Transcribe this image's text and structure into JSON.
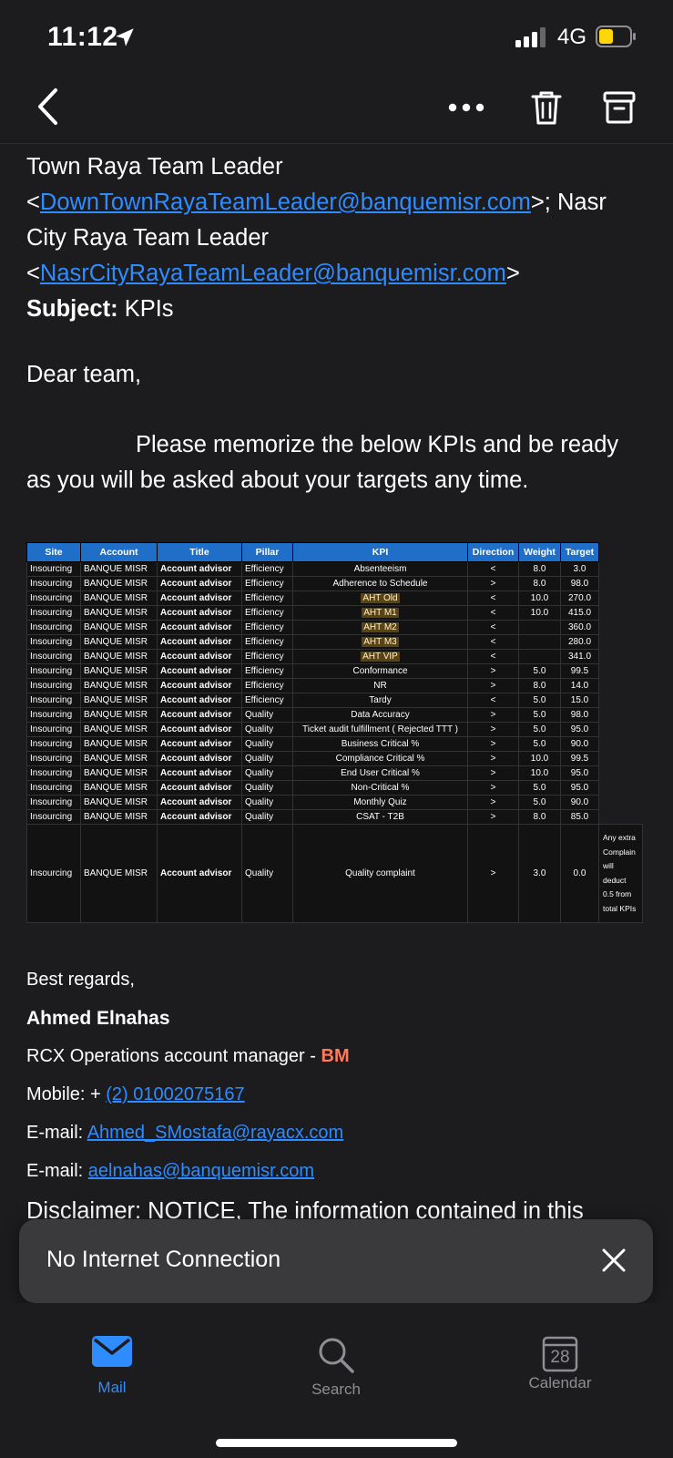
{
  "status": {
    "time": "11:12",
    "network": "4G"
  },
  "email": {
    "to_line1": "Town Raya Team Leader",
    "to_lt1": "<",
    "to_email1": "DownTownRayaTeamLeader@banquemisr.com",
    "to_after1": ">; Nasr",
    "to_line3": "City Raya Team Leader",
    "to_lt2": "<",
    "to_email2": "NasrCityRayaTeamLeader@banquemisr.com",
    "to_gt2": ">",
    "subject_label": "Subject:",
    "subject_value": "KPIs",
    "greeting": "Dear team,",
    "body_line1": "Please memorize the below KPIs and be ready",
    "body_line2": "as you will be asked about your targets any time."
  },
  "kpi_table": {
    "headers": [
      "Site",
      "Account",
      "Title",
      "Pillar",
      "KPI",
      "Direction",
      "Weight",
      "Target"
    ],
    "rows": [
      [
        "Insourcing",
        "BANQUE MISR",
        "Account advisor",
        "Efficiency",
        "Absenteeism",
        "<",
        "8.0",
        "3.0"
      ],
      [
        "Insourcing",
        "BANQUE MISR",
        "Account advisor",
        "Efficiency",
        "Adherence to Schedule",
        ">",
        "8.0",
        "98.0"
      ],
      [
        "Insourcing",
        "BANQUE MISR",
        "Account advisor",
        "Efficiency",
        "AHT Old",
        "<",
        "10.0",
        "270.0"
      ],
      [
        "Insourcing",
        "BANQUE MISR",
        "Account advisor",
        "Efficiency",
        "AHT M1",
        "<",
        "10.0",
        "415.0"
      ],
      [
        "Insourcing",
        "BANQUE MISR",
        "Account advisor",
        "Efficiency",
        "AHT M2",
        "<",
        "",
        "360.0"
      ],
      [
        "Insourcing",
        "BANQUE MISR",
        "Account advisor",
        "Efficiency",
        "AHT M3",
        "<",
        "",
        "280.0"
      ],
      [
        "Insourcing",
        "BANQUE MISR",
        "Account advisor",
        "Efficiency",
        "AHT VIP",
        "<",
        "",
        "341.0"
      ],
      [
        "Insourcing",
        "BANQUE MISR",
        "Account advisor",
        "Efficiency",
        "Conformance",
        ">",
        "5.0",
        "99.5"
      ],
      [
        "Insourcing",
        "BANQUE MISR",
        "Account advisor",
        "Efficiency",
        "NR",
        ">",
        "8.0",
        "14.0"
      ],
      [
        "Insourcing",
        "BANQUE MISR",
        "Account advisor",
        "Efficiency",
        "Tardy",
        "<",
        "5.0",
        "15.0"
      ],
      [
        "Insourcing",
        "BANQUE MISR",
        "Account advisor",
        "Quality",
        "Data Accuracy",
        ">",
        "5.0",
        "98.0"
      ],
      [
        "Insourcing",
        "BANQUE MISR",
        "Account advisor",
        "Quality",
        "Ticket audit fulfillment ( Rejected TTT )",
        ">",
        "5.0",
        "95.0"
      ],
      [
        "Insourcing",
        "BANQUE MISR",
        "Account advisor",
        "Quality",
        "Business Critical %",
        ">",
        "5.0",
        "90.0"
      ],
      [
        "Insourcing",
        "BANQUE MISR",
        "Account advisor",
        "Quality",
        "Compliance Critical %",
        ">",
        "10.0",
        "99.5"
      ],
      [
        "Insourcing",
        "BANQUE MISR",
        "Account advisor",
        "Quality",
        "End User Critical %",
        ">",
        "10.0",
        "95.0"
      ],
      [
        "Insourcing",
        "BANQUE MISR",
        "Account advisor",
        "Quality",
        "Non-Critical %",
        ">",
        "5.0",
        "95.0"
      ],
      [
        "Insourcing",
        "BANQUE MISR",
        "Account advisor",
        "Quality",
        "Monthly Quiz",
        ">",
        "5.0",
        "90.0"
      ],
      [
        "Insourcing",
        "BANQUE MISR",
        "Account advisor",
        "Quality",
        "CSAT - T2B",
        ">",
        "8.0",
        "85.0"
      ]
    ],
    "highlighted_kpis": [
      "AHT Old",
      "AHT M1",
      "AHT M2",
      "AHT M3",
      "AHT VIP"
    ],
    "last_row": [
      "Insourcing",
      "BANQUE MISR",
      "Account advisor",
      "Quality",
      "Quality complaint",
      ">",
      "3.0",
      "0.0"
    ],
    "last_row_note": "Any extra Complain will deduct 0.5 from total KPIs"
  },
  "signature": {
    "closing": "Best regards,",
    "name": "Ahmed Elnahas",
    "role_text": "RCX Operations account manager - ",
    "role_accent": "BM",
    "mobile_label": "Mobile: + ",
    "mobile_value": "(2) 01002075167",
    "email1_label": "E-mail: ",
    "email1_value": "Ahmed_SMostafa@rayacx.com",
    "email2_label": "E-mail: ",
    "email2_value": "aelnahas@banquemisr.com",
    "disclaimer": "Disclaimer: NOTICE, The information contained in this"
  },
  "toast": {
    "message": "No Internet Connection"
  },
  "tabs": [
    {
      "label": "Mail",
      "icon": "mail-icon",
      "active": true
    },
    {
      "label": "Search",
      "icon": "search-icon",
      "active": false
    },
    {
      "label": "Calendar",
      "icon": "calendar-icon",
      "active": false,
      "badge": "28"
    }
  ],
  "colors": {
    "accent": "#2f8cff",
    "table_header": "#1f6fc8",
    "highlight": "#5a4417",
    "bm": "#ff7b5a"
  }
}
